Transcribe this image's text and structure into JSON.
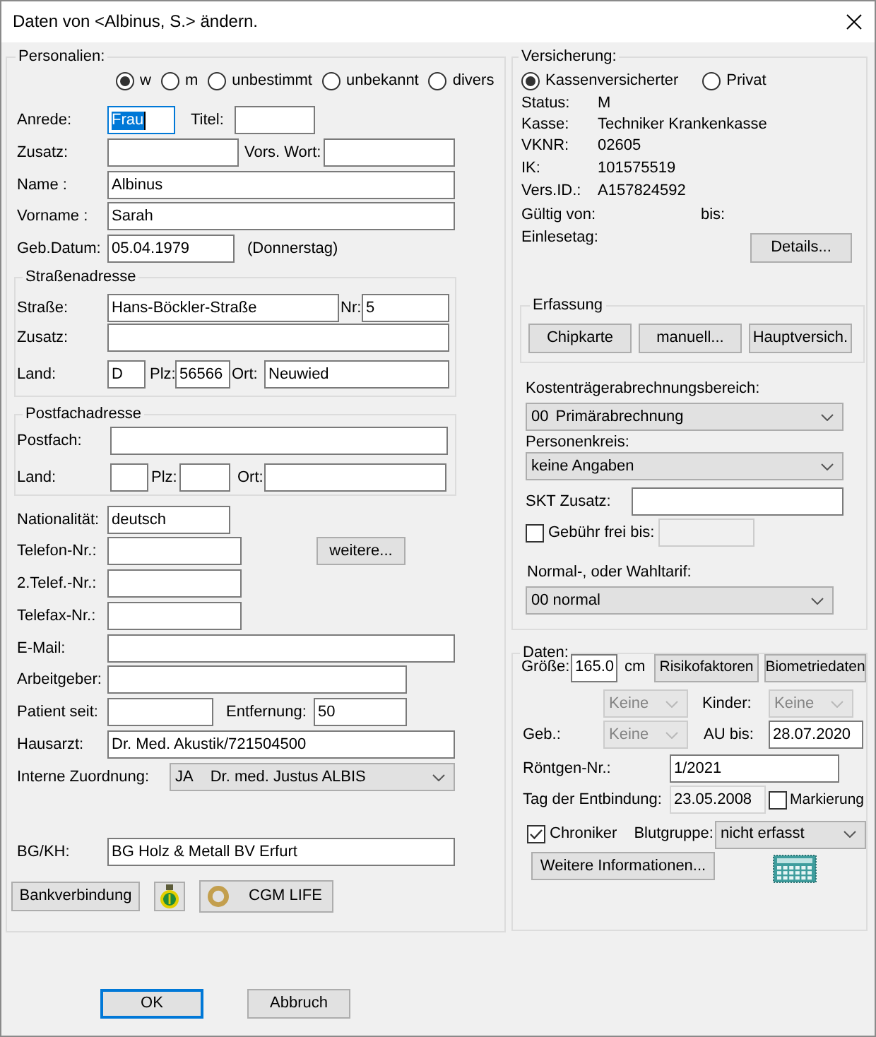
{
  "window": {
    "title": "Daten von <Albinus, S.> ändern."
  },
  "personalien": {
    "legend": "Personalien:",
    "geschlecht": [
      {
        "label": "w",
        "selected": true
      },
      {
        "label": "m",
        "selected": false
      },
      {
        "label": "unbestimmt",
        "selected": false
      },
      {
        "label": "unbekannt",
        "selected": false
      },
      {
        "label": "divers",
        "selected": false
      }
    ],
    "anrede": {
      "label": "Anrede:",
      "value": "Frau",
      "focused": true
    },
    "titel": {
      "label": "Titel:"
    },
    "zusatz": {
      "label": "Zusatz:"
    },
    "vorsatzwort": {
      "label": "Vors. Wort:"
    },
    "name": {
      "label": "Name :",
      "value": "Albinus"
    },
    "vorname": {
      "label": "Vorname :",
      "value": "Sarah"
    },
    "geburtsdatum": {
      "label": "Geb.Datum:",
      "value": "05.04.1979",
      "wochentag": "(Donnerstag)"
    },
    "strassenadresse": {
      "legend": "Straßenadresse",
      "strasse": {
        "label": "Straße:",
        "value": "Hans-Böckler-Straße"
      },
      "nr": {
        "label": "Nr:",
        "value": "5"
      },
      "zusatz": {
        "label": "Zusatz:"
      },
      "land": {
        "label": "Land:",
        "value": "D"
      },
      "plz": {
        "label": "Plz:",
        "value": "56566"
      },
      "ort": {
        "label": "Ort:",
        "value": "Neuwied"
      }
    },
    "postfachadresse": {
      "legend": "Postfachadresse",
      "postfach": {
        "label": "Postfach:"
      },
      "land": {
        "label": "Land:"
      },
      "plz": {
        "label": "Plz:"
      },
      "ort": {
        "label": "Ort:"
      }
    },
    "nationalitaet": {
      "label": "Nationalität:",
      "value": "deutsch"
    },
    "telefon": {
      "label": "Telefon-Nr.:"
    },
    "weitere_button": "weitere...",
    "telefon_2": {
      "label": "2.Telef.-Nr.:"
    },
    "telefax": {
      "label": "Telefax-Nr.:"
    },
    "email": {
      "label": "E-Mail:"
    },
    "arbeitgeber": {
      "label": "Arbeitgeber:"
    },
    "patient_seit": {
      "label": "Patient seit:"
    },
    "entfernung": {
      "label": "Entfernung:",
      "value": "50"
    },
    "hausarzt": {
      "label": "Hausarzt:",
      "value": "Dr. Med. Akustik/721504500"
    },
    "interne_zuordnung": {
      "label": "Interne Zuordnung:",
      "code": "JA",
      "value": "Dr. med. Justus ALBIS"
    },
    "bg_kh": {
      "label": "BG/KH:",
      "value": "BG Holz & Metall BV Erfurt"
    },
    "buttons": [
      {
        "kind": "text",
        "label": "Bankverbindung"
      },
      {
        "kind": "icon"
      },
      {
        "kind": "ring",
        "label": "CGM LIFE"
      }
    ]
  },
  "versicherung": {
    "legend": "Versicherung:",
    "art": [
      {
        "label": "Kassenversicherter",
        "selected": true
      },
      {
        "label": "Privat",
        "selected": false
      }
    ],
    "angaben": [
      {
        "label": "Status:",
        "value": "M"
      },
      {
        "label": "Kasse:",
        "value": "Techniker Krankenkasse"
      },
      {
        "label": "VKNR:",
        "value": "02605"
      },
      {
        "label": "IK:",
        "value": "101575519"
      },
      {
        "label": "Vers.ID.:",
        "value": "A157824592"
      }
    ],
    "gueltig_von": "Gültig von:",
    "bis": "bis:",
    "einlesetag": "Einlesetag:",
    "details_button": "Details...",
    "erfassung": {
      "legend": "Erfassung",
      "buttons": [
        "Chipkarte",
        "manuell...",
        "Hauptversich."
      ]
    },
    "kostentraeger": {
      "label": "Kostenträgerabrechnungsbereich:",
      "code": "00",
      "value": "Primärabrechnung"
    },
    "personenkreis": {
      "label": "Personenkreis:",
      "value": "keine Angaben"
    },
    "skt_zusatz": {
      "label": "SKT Zusatz:"
    },
    "gebuehr_frei": {
      "label": "Gebühr frei bis:",
      "checked": false
    },
    "gebuehr_frei_bis": {
      "disabled": true
    },
    "tarif": {
      "label": "Normal-, oder Wahltarif:",
      "value": "00 normal"
    }
  },
  "daten": {
    "legend": "Daten:",
    "groesse": {
      "label": "Größe:",
      "value": "165.0",
      "unit": "cm"
    },
    "buttons": [
      "Risikofaktoren",
      "Biometriedaten"
    ],
    "dropdown_1": {
      "value": "Keine",
      "disabled": true
    },
    "kinder": {
      "label": "Kinder:",
      "value": "Keine",
      "disabled": true
    },
    "geb": {
      "label": "Geb.:",
      "value": "Keine",
      "disabled": true
    },
    "au_bis": {
      "label": "AU bis:",
      "value": "28.07.2020"
    },
    "roentgen_nr": {
      "label": "Röntgen-Nr.:",
      "value": "1/2021"
    },
    "entbindung": {
      "label": "Tag der Entbindung:",
      "value": "23.05.2008",
      "readonly": true
    },
    "markierung": {
      "label": "Markierung",
      "checked": false
    },
    "chroniker": {
      "label": "Chroniker",
      "checked": true
    },
    "blutgruppe": {
      "label": "Blutgruppe:",
      "value": "nicht erfasst"
    },
    "weitere_button": "Weitere Informationen..."
  },
  "footer": {
    "buttons": [
      {
        "label": "OK",
        "default": true
      },
      {
        "label": "Abbruch",
        "default": false
      }
    ]
  }
}
